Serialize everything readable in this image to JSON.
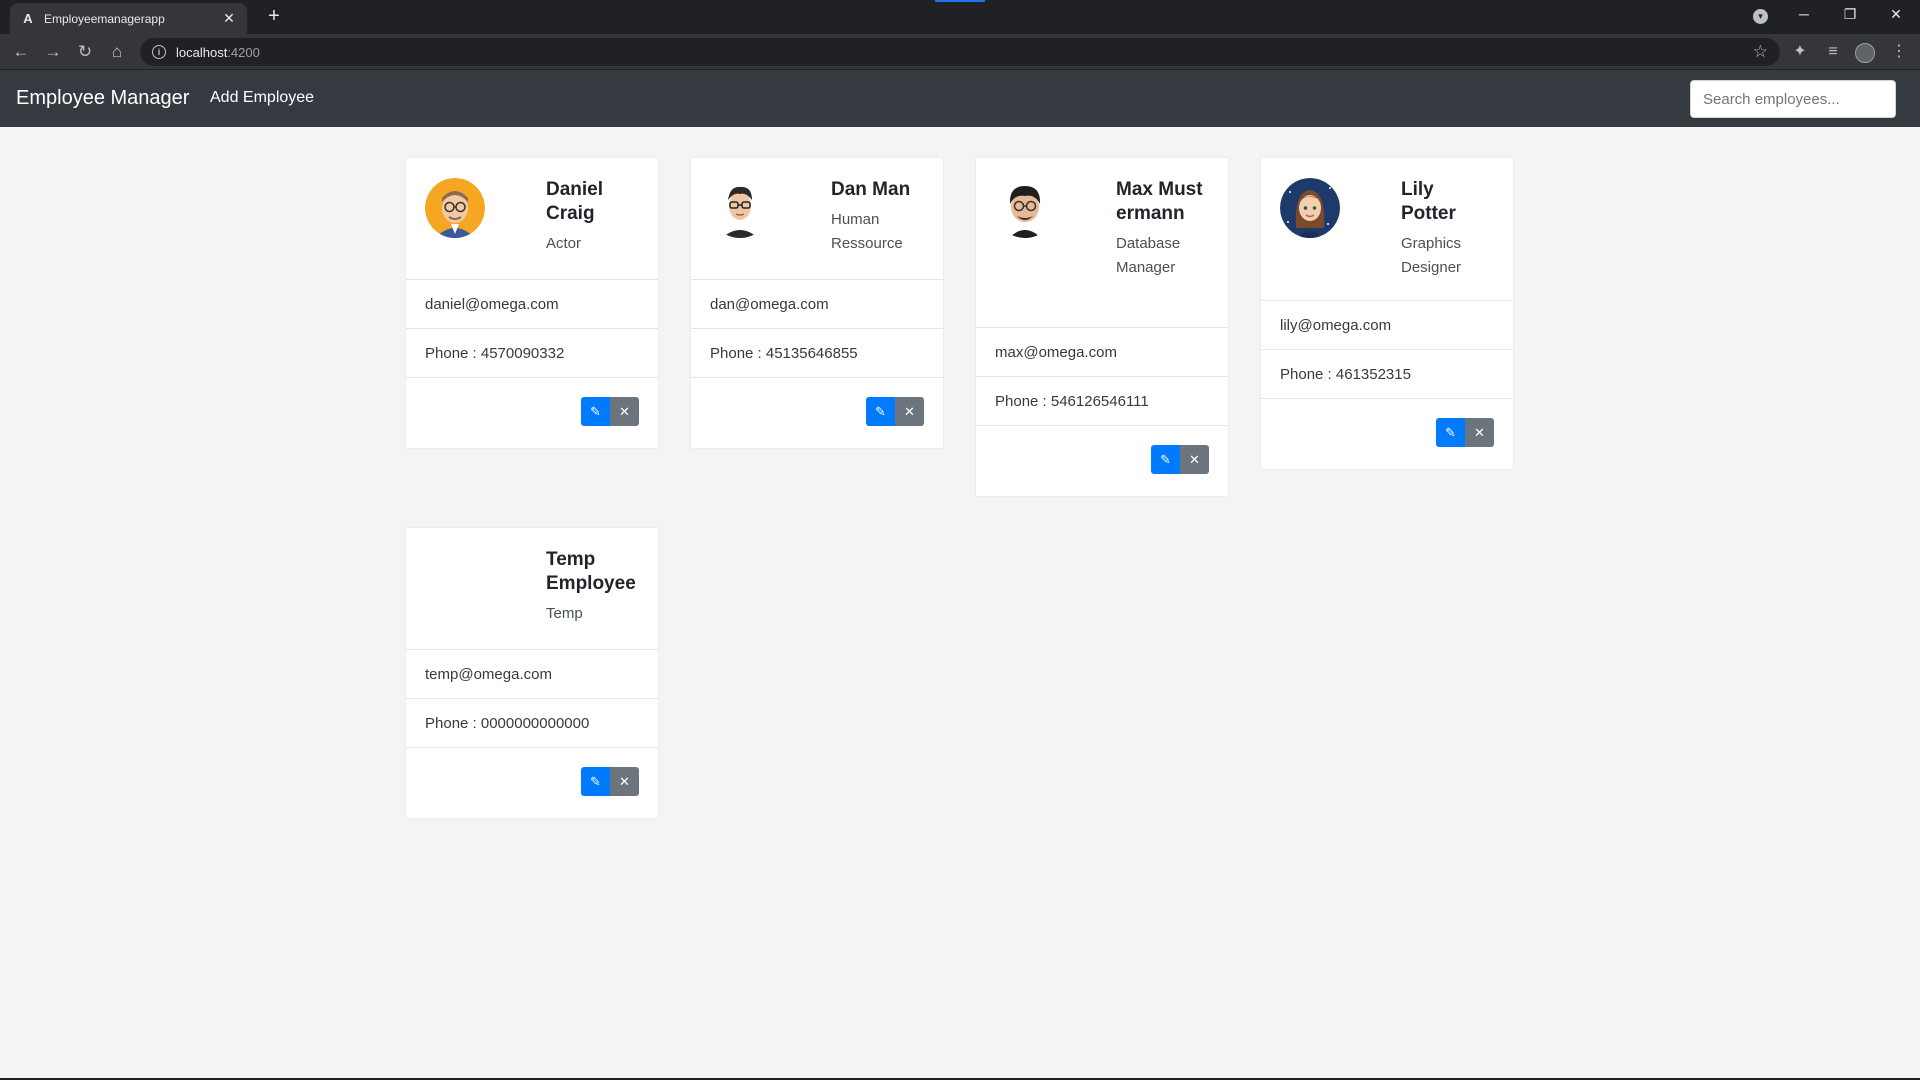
{
  "browser": {
    "tab_title": "Employeemanagerapp",
    "tab_favicon": "A",
    "close_glyph": "✕",
    "newtab_glyph": "+",
    "url_host": "localhost",
    "url_port": ":4200"
  },
  "app": {
    "brand": "Employee Manager",
    "add_link": "Add Employee",
    "search_placeholder": "Search employees..."
  },
  "employees": [
    {
      "name": "Daniel Craig",
      "job": "Actor",
      "email": "daniel@omega.com",
      "phone": "Phone : 4570090332",
      "avatar": "avatar-daniel"
    },
    {
      "name": "Dan Man",
      "job": "Human Ressource",
      "email": "dan@omega.com",
      "phone": "Phone : 45135646855",
      "avatar": "avatar-dan"
    },
    {
      "name": "Max Mustermann",
      "job": "Database Manager",
      "email": "max@omega.com",
      "phone": "Phone : 546126546111",
      "avatar": "avatar-max"
    },
    {
      "name": "Lily Potter",
      "job": "Graphics Designer",
      "email": "lily@omega.com",
      "phone": "Phone : 461352315",
      "avatar": "avatar-lily"
    },
    {
      "name": "Temp Employee",
      "job": "Temp",
      "email": "temp@omega.com",
      "phone": "Phone : 0000000000000",
      "avatar": ""
    }
  ],
  "icons": {
    "edit": "pencil-icon",
    "delete": "times-icon"
  },
  "colors": {
    "navbar": "#343a40",
    "edit_button": "#007bff",
    "delete_button": "#6c757d",
    "page_bg": "#f4f4f4"
  }
}
